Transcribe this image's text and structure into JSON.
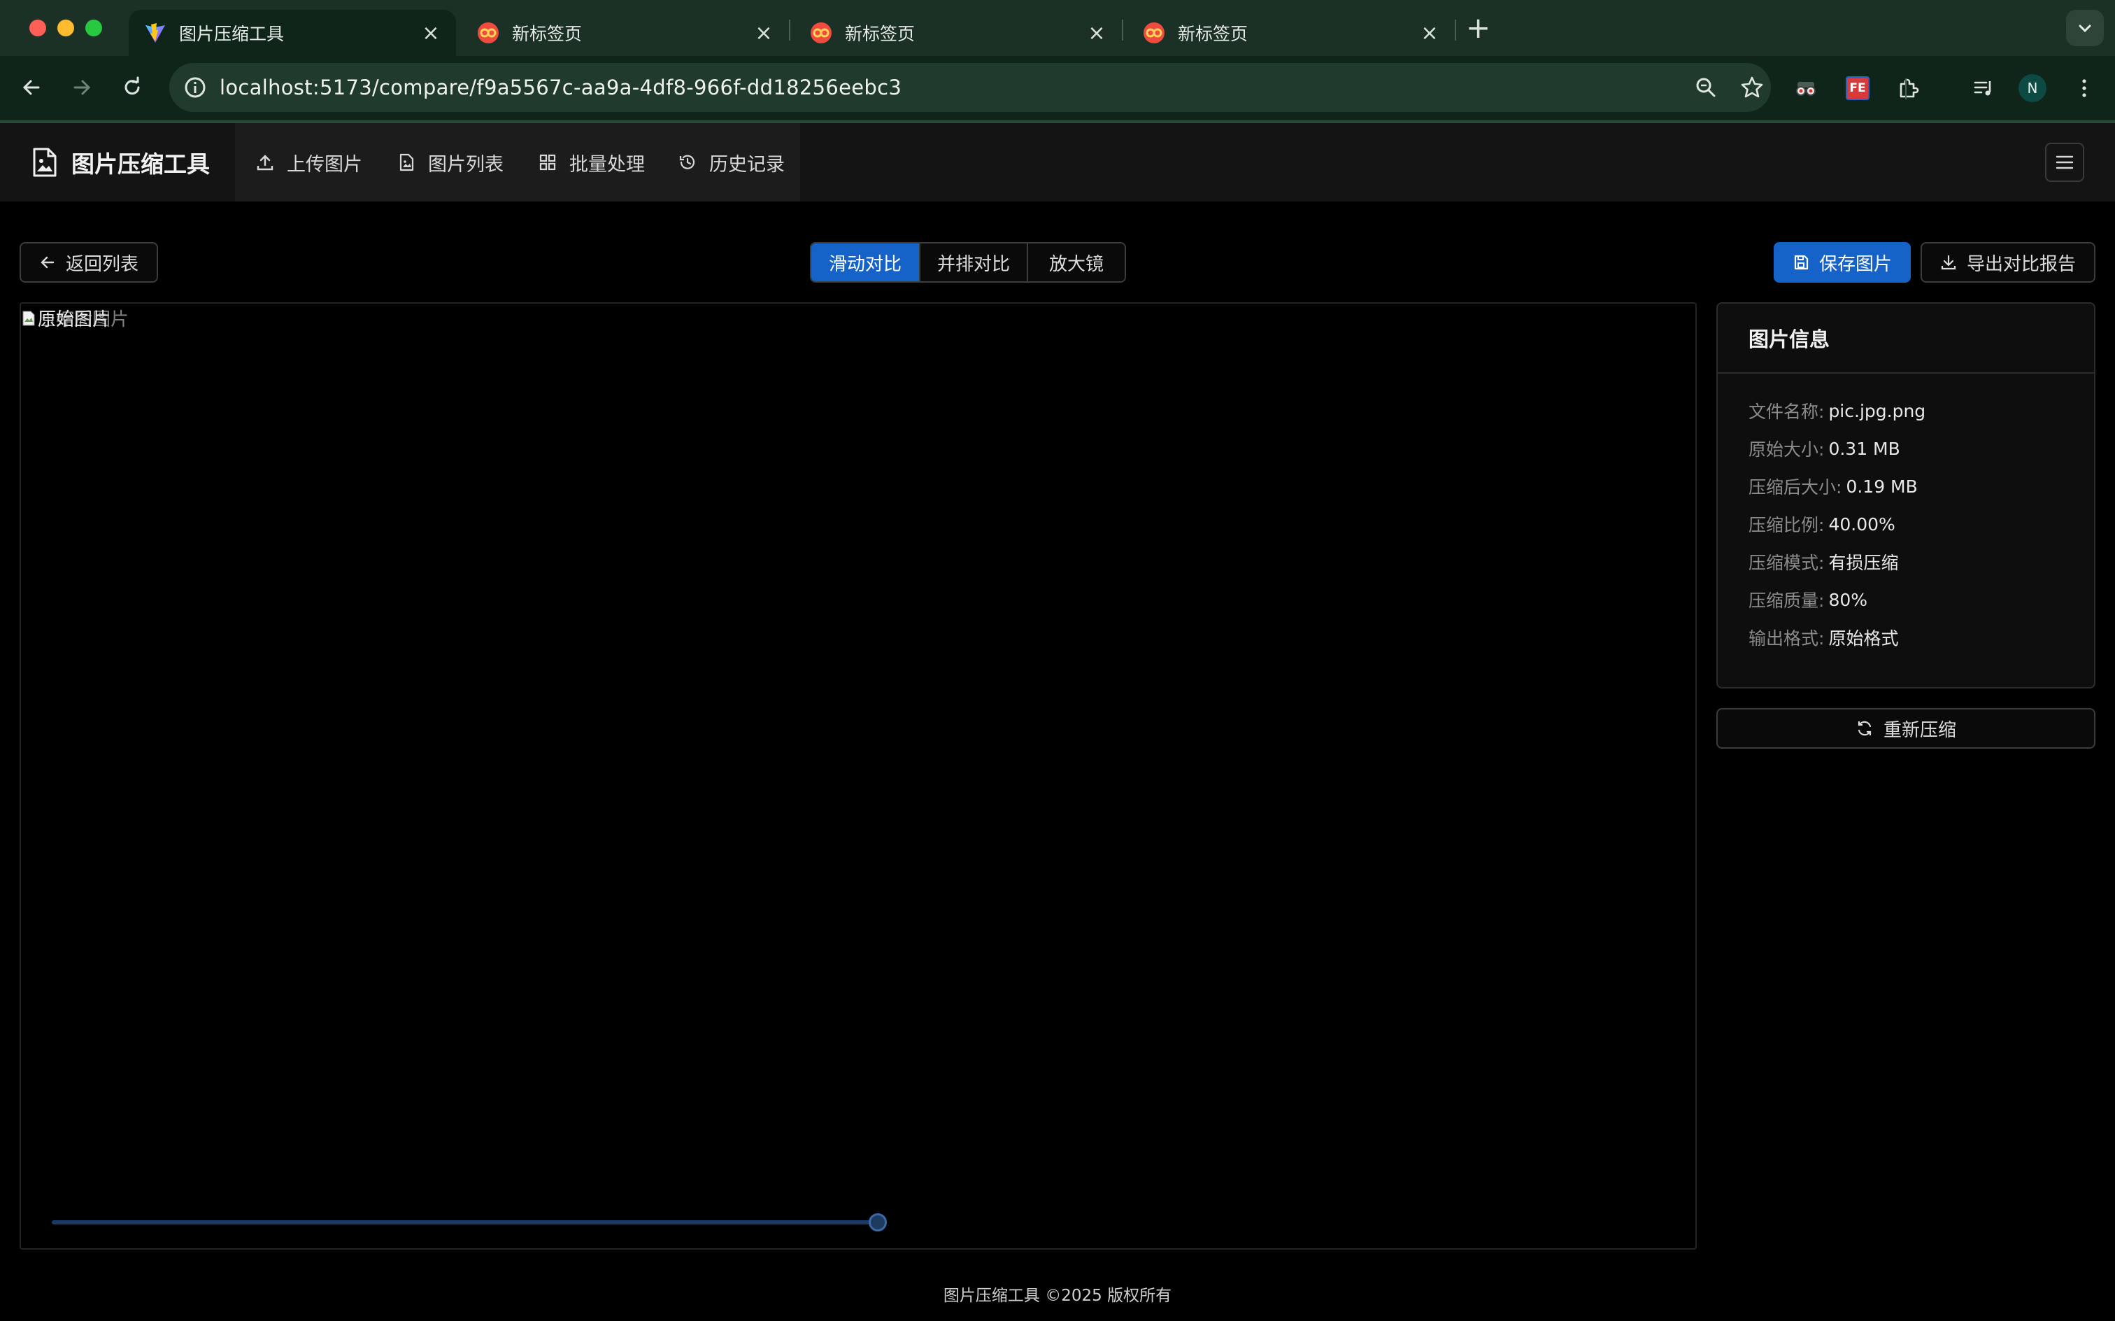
{
  "browser": {
    "tabs": [
      {
        "label": "图片压缩工具",
        "favicon": "vite-favicon-icon",
        "active": true
      },
      {
        "label": "新标签页",
        "favicon": "new-tab-favicon-icon",
        "active": false
      },
      {
        "label": "新标签页",
        "favicon": "new-tab-favicon-icon",
        "active": false
      },
      {
        "label": "新标签页",
        "favicon": "new-tab-favicon-icon",
        "active": false
      }
    ],
    "url": "localhost:5173/compare/f9a5567c-aa9a-4df8-966f-dd18256eebc3",
    "profile_initial": "N",
    "extension_fe_label": "FE"
  },
  "app": {
    "brand": "图片压缩工具",
    "menu": [
      {
        "label": "上传图片",
        "icon": "upload-icon"
      },
      {
        "label": "图片列表",
        "icon": "file-image-icon"
      },
      {
        "label": "批量处理",
        "icon": "grid-icon"
      },
      {
        "label": "历史记录",
        "icon": "history-icon"
      }
    ]
  },
  "actions": {
    "back": "返回列表",
    "view_modes": [
      "滑动对比",
      "并排对比",
      "放大镜"
    ],
    "active_mode": "滑动对比",
    "save": "保存图片",
    "export": "导出对比报告"
  },
  "viewer": {
    "image_alt": "原始图片",
    "image_alt_overlay": "压缩后图片",
    "slider_percent": 50
  },
  "info": {
    "title": "图片信息",
    "rows": [
      {
        "label": "文件名称:",
        "value": "pic.jpg.png"
      },
      {
        "label": "原始大小:",
        "value": "0.31 MB"
      },
      {
        "label": "压缩后大小:",
        "value": "0.19 MB"
      },
      {
        "label": "压缩比例:",
        "value": "40.00%"
      },
      {
        "label": "压缩模式:",
        "value": "有损压缩"
      },
      {
        "label": "压缩质量:",
        "value": "80%"
      },
      {
        "label": "输出格式:",
        "value": "原始格式"
      }
    ],
    "recompress": "重新压缩"
  },
  "footer": "图片压缩工具 ©2025 版权所有",
  "colors": {
    "primary": "#1563c8",
    "chrome_bg": "#1c3125",
    "page_bg": "#000000"
  }
}
